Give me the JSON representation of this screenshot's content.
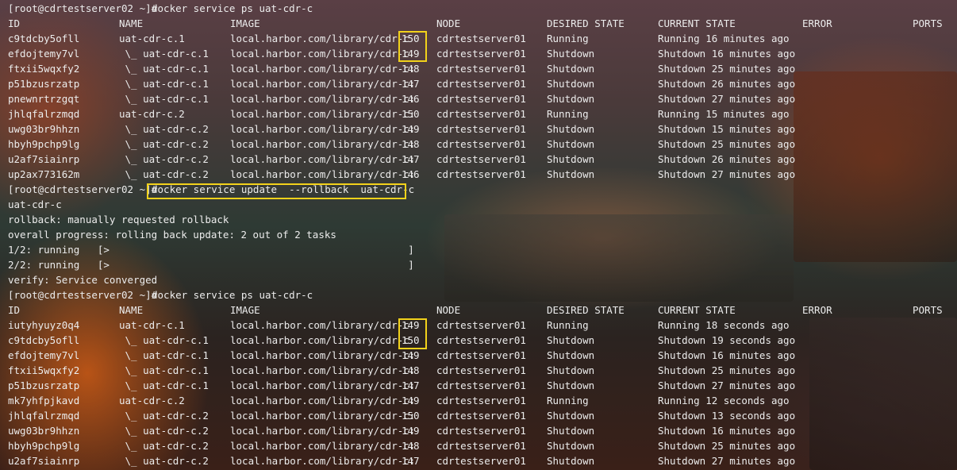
{
  "prompt": "[root@cdrtestserver02 ~]#",
  "commands": {
    "ps1": "docker service ps uat-cdr-c",
    "update": "docker service update  --rollback  uat-cdr-c",
    "ps2": "docker service ps uat-cdr-c"
  },
  "headers": [
    "ID",
    "NAME",
    "IMAGE",
    "NODE",
    "DESIRED STATE",
    "CURRENT STATE",
    "ERROR",
    "PORTS"
  ],
  "table1": [
    [
      "c9tdcby5ofll",
      "uat-cdr-c.1",
      "local.harbor.com/library/cdr-c",
      "150",
      "cdrtestserver01",
      "Running",
      "Running 16 minutes ago"
    ],
    [
      "efdojtemy7vl",
      " \\_ uat-cdr-c.1",
      "local.harbor.com/library/cdr-c",
      "149",
      "cdrtestserver01",
      "Shutdown",
      "Shutdown 16 minutes ago"
    ],
    [
      "ftxii5wqxfy2",
      " \\_ uat-cdr-c.1",
      "local.harbor.com/library/cdr-c:",
      "148",
      "cdrtestserver01",
      "Shutdown",
      "Shutdown 25 minutes ago"
    ],
    [
      "p51bzusrzatp",
      " \\_ uat-cdr-c.1",
      "local.harbor.com/library/cdr-c:",
      "147",
      "cdrtestserver01",
      "Shutdown",
      "Shutdown 26 minutes ago"
    ],
    [
      "pnewnrtrzgqt",
      " \\_ uat-cdr-c.1",
      "local.harbor.com/library/cdr-c:",
      "146",
      "cdrtestserver01",
      "Shutdown",
      "Shutdown 27 minutes ago"
    ],
    [
      "jhlqfalrzmqd",
      "uat-cdr-c.2",
      "local.harbor.com/library/cdr-c:",
      "150",
      "cdrtestserver01",
      "Running",
      "Running 15 minutes ago"
    ],
    [
      "uwg03br9hhzn",
      " \\_ uat-cdr-c.2",
      "local.harbor.com/library/cdr-c:",
      "149",
      "cdrtestserver01",
      "Shutdown",
      "Shutdown 15 minutes ago"
    ],
    [
      "hbyh9pchp9lg",
      " \\_ uat-cdr-c.2",
      "local.harbor.com/library/cdr-c:",
      "148",
      "cdrtestserver01",
      "Shutdown",
      "Shutdown 25 minutes ago"
    ],
    [
      "u2af7siainrp",
      " \\_ uat-cdr-c.2",
      "local.harbor.com/library/cdr-c:",
      "147",
      "cdrtestserver01",
      "Shutdown",
      "Shutdown 26 minutes ago"
    ],
    [
      "up2ax773162m",
      " \\_ uat-cdr-c.2",
      "local.harbor.com/library/cdr-c:",
      "146",
      "cdrtestserver01",
      "Shutdown",
      "Shutdown 27 minutes ago"
    ]
  ],
  "output": [
    "uat-cdr-c",
    "rollback: manually requested rollback",
    "overall progress: rolling back update: 2 out of 2 tasks",
    "1/2: running   [>                                                  ]",
    "2/2: running   [>                                                  ]",
    "verify: Service converged"
  ],
  "table2": [
    [
      "iutyhyuyz0q4",
      "uat-cdr-c.1",
      "local.harbor.com/library/cdr-c",
      "149",
      "cdrtestserver01",
      "Running",
      "Running 18 seconds ago"
    ],
    [
      "c9tdcby5ofll",
      " \\_ uat-cdr-c.1",
      "local.harbor.com/library/cdr-c",
      "150",
      "cdrtestserver01",
      "Shutdown",
      "Shutdown 19 seconds ago"
    ],
    [
      "efdojtemy7vl",
      " \\_ uat-cdr-c.1",
      "local.harbor.com/library/cdr-c:",
      "149",
      "cdrtestserver01",
      "Shutdown",
      "Shutdown 16 minutes ago"
    ],
    [
      "ftxii5wqxfy2",
      " \\_ uat-cdr-c.1",
      "local.harbor.com/library/cdr-c:",
      "148",
      "cdrtestserver01",
      "Shutdown",
      "Shutdown 25 minutes ago"
    ],
    [
      "p51bzusrzatp",
      " \\_ uat-cdr-c.1",
      "local.harbor.com/library/cdr-c:",
      "147",
      "cdrtestserver01",
      "Shutdown",
      "Shutdown 27 minutes ago"
    ],
    [
      "mk7yhfpjkavd",
      "uat-cdr-c.2",
      "local.harbor.com/library/cdr-c:",
      "149",
      "cdrtestserver01",
      "Running",
      "Running 12 seconds ago"
    ],
    [
      "jhlqfalrzmqd",
      " \\_ uat-cdr-c.2",
      "local.harbor.com/library/cdr-c:",
      "150",
      "cdrtestserver01",
      "Shutdown",
      "Shutdown 13 seconds ago"
    ],
    [
      "uwg03br9hhzn",
      " \\_ uat-cdr-c.2",
      "local.harbor.com/library/cdr-c:",
      "149",
      "cdrtestserver01",
      "Shutdown",
      "Shutdown 16 minutes ago"
    ],
    [
      "hbyh9pchp9lg",
      " \\_ uat-cdr-c.2",
      "local.harbor.com/library/cdr-c:",
      "148",
      "cdrtestserver01",
      "Shutdown",
      "Shutdown 25 minutes ago"
    ],
    [
      "u2af7siainrp",
      " \\_ uat-cdr-c.2",
      "local.harbor.com/library/cdr-c:",
      "147",
      "cdrtestserver01",
      "Shutdown",
      "Shutdown 27 minutes ago"
    ]
  ],
  "colors": {
    "text": "#ececec",
    "highlight": "#f2d21b"
  }
}
